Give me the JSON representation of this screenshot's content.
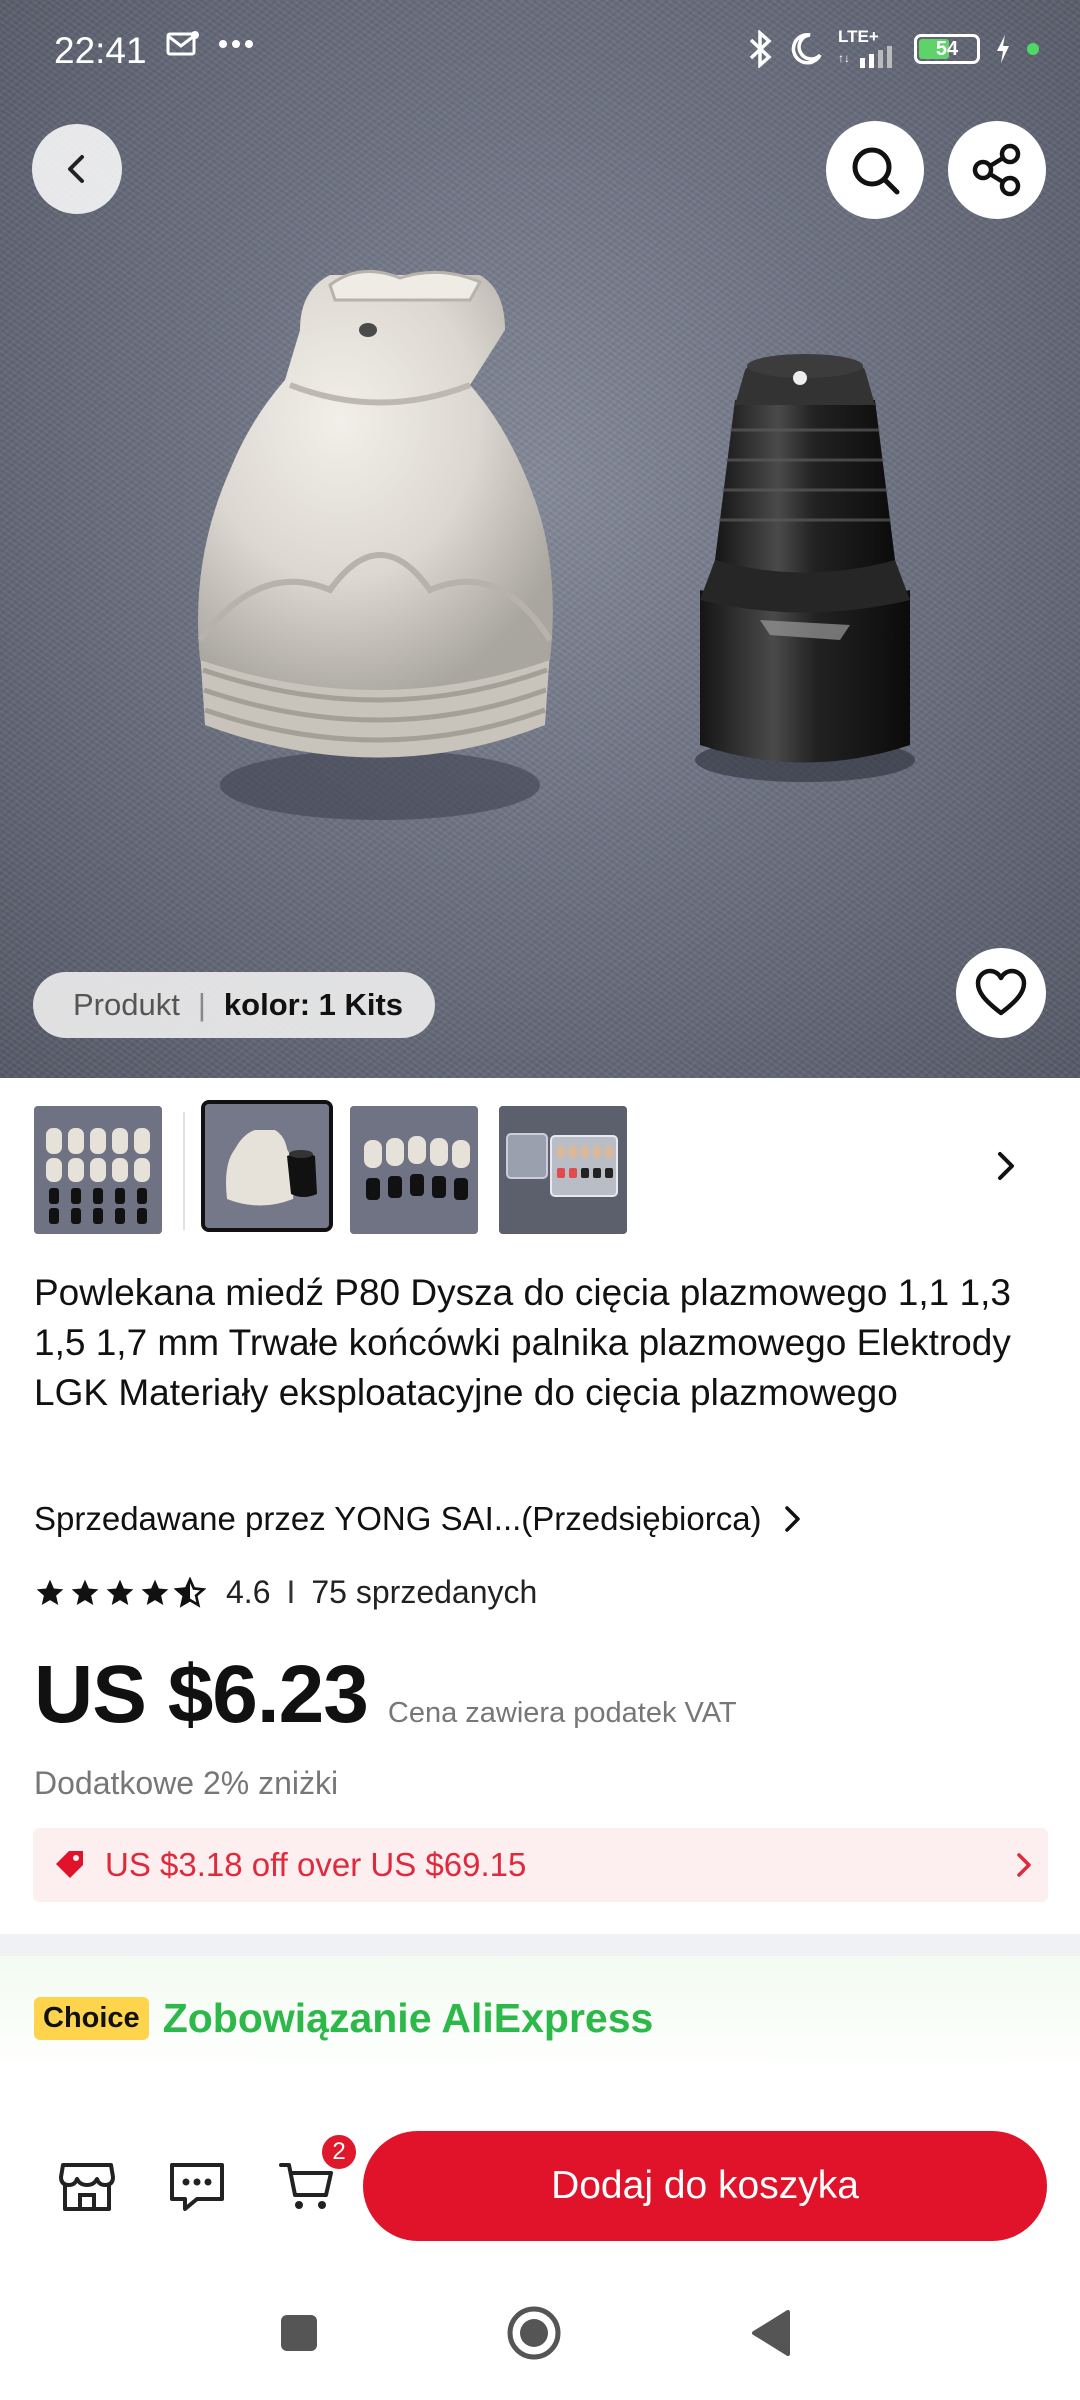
{
  "status_bar": {
    "time": "22:41",
    "left_icons": [
      "mail-icon",
      "more-dots-icon"
    ],
    "network": "LTE+",
    "battery": "54",
    "right_icons": [
      "bluetooth-icon",
      "moon-icon",
      "signal-icon",
      "battery-icon",
      "charging-icon"
    ]
  },
  "hero": {
    "variant_label": "Produkt",
    "variant_separator": "|",
    "variant_value": "kolor: 1 Kits",
    "buttons": [
      "back-icon",
      "search-icon",
      "share-icon",
      "heart-icon"
    ]
  },
  "thumbnails": {
    "count": 4,
    "selected_index": 1,
    "next_icon": "chevron-right-icon"
  },
  "product": {
    "title": "Powlekana miedź P80 Dysza do cięcia plazmowego 1,1 1,3 1,5 1,7 mm Trwałe końcówki palnika plazmowego Elektrody LGK Materiały eksploatacyjne do cięcia plazmowego",
    "seller": "Sprzedawane przez YONG SAI...(Przedsiębiorca)",
    "rating": "4.6",
    "rating_stars": 4.6,
    "rating_separator": "I",
    "sold": "75 sprzedanych",
    "price": "US $6.23",
    "price_note": "Cena zawiera podatek VAT",
    "extra_discount": "Dodatkowe 2% zniżki",
    "coupon": "US $3.18 off over US $69.15"
  },
  "choice": {
    "badge": "Choice",
    "text": "Zobowiązanie AliExpress"
  },
  "action_bar": {
    "cart_count": "2",
    "add_to_cart": "Dodaj do koszyka"
  },
  "colors": {
    "accent_red": "#e0132a",
    "coupon_text": "#e02a3c",
    "coupon_bg": "#fdeef0",
    "choice_green": "#2db84a",
    "choice_badge": "#ffd44d"
  }
}
